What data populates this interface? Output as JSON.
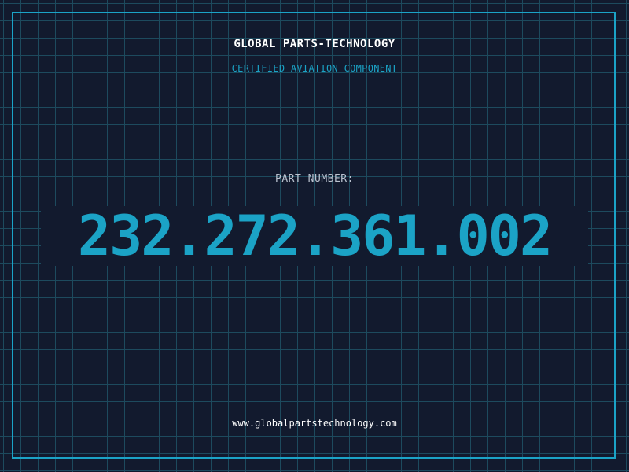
{
  "header": {
    "brand": "GLOBAL PARTS-TECHNOLOGY",
    "tagline": "CERTIFIED AVIATION COMPONENT"
  },
  "part": {
    "label": "PART NUMBER:",
    "number": "232.272.361.002"
  },
  "footer": {
    "website": "www.globalpartstechnology.com"
  },
  "colors": {
    "background": "#121a2e",
    "grid": "#1d4a5e",
    "accent": "#1ba3c6",
    "text": "#ffffff",
    "muted": "#b9c2cf"
  }
}
